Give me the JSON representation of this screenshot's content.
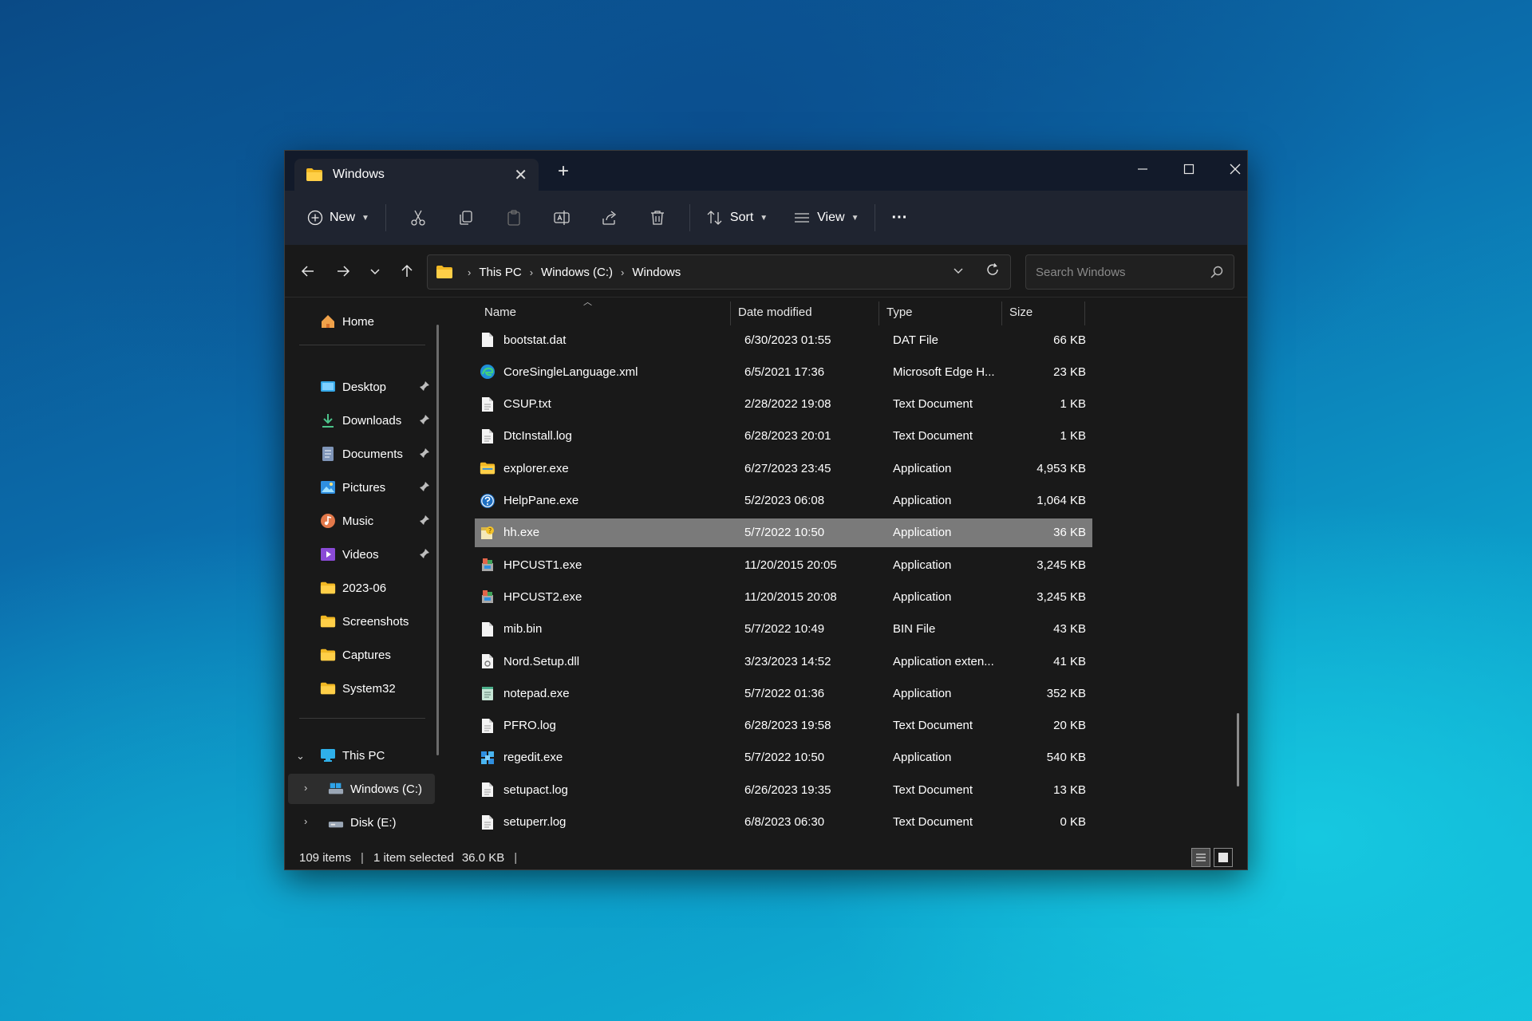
{
  "window": {
    "tab_title": "Windows",
    "new_tab": "+",
    "close_tab": "✕"
  },
  "toolbar": {
    "new_label": "New",
    "sort_label": "Sort",
    "view_label": "View",
    "more_label": "···"
  },
  "address": {
    "crumbs": [
      "This PC",
      "Windows (C:)",
      "Windows"
    ]
  },
  "search": {
    "placeholder": "Search Windows"
  },
  "sidebar": {
    "home": "Home",
    "quick": [
      {
        "label": "Desktop",
        "icon": "desktop-icon"
      },
      {
        "label": "Downloads",
        "icon": "download-icon"
      },
      {
        "label": "Documents",
        "icon": "document-icon"
      },
      {
        "label": "Pictures",
        "icon": "pictures-icon"
      },
      {
        "label": "Music",
        "icon": "music-icon"
      },
      {
        "label": "Videos",
        "icon": "videos-icon"
      },
      {
        "label": "2023-06",
        "icon": "folder-icon"
      },
      {
        "label": "Screenshots",
        "icon": "folder-icon"
      },
      {
        "label": "Captures",
        "icon": "folder-icon"
      },
      {
        "label": "System32",
        "icon": "folder-icon"
      }
    ],
    "this_pc": "This PC",
    "drives": [
      {
        "label": "Windows (C:)"
      },
      {
        "label": "Disk (E:)"
      }
    ]
  },
  "columns": {
    "name": "Name",
    "date": "Date modified",
    "type": "Type",
    "size": "Size"
  },
  "files": [
    {
      "name": "bootstat.dat",
      "date": "6/30/2023 01:55",
      "type": "DAT File",
      "size": "66 KB",
      "icon": "file-icon"
    },
    {
      "name": "CoreSingleLanguage.xml",
      "date": "6/5/2021 17:36",
      "type": "Microsoft Edge H...",
      "size": "23 KB",
      "icon": "edge-icon"
    },
    {
      "name": "CSUP.txt",
      "date": "2/28/2022 19:08",
      "type": "Text Document",
      "size": "1 KB",
      "icon": "text-file-icon"
    },
    {
      "name": "DtcInstall.log",
      "date": "6/28/2023 20:01",
      "type": "Text Document",
      "size": "1 KB",
      "icon": "text-file-icon"
    },
    {
      "name": "explorer.exe",
      "date": "6/27/2023 23:45",
      "type": "Application",
      "size": "4,953 KB",
      "icon": "explorer-icon"
    },
    {
      "name": "HelpPane.exe",
      "date": "5/2/2023 06:08",
      "type": "Application",
      "size": "1,064 KB",
      "icon": "help-icon"
    },
    {
      "name": "hh.exe",
      "date": "5/7/2022 10:50",
      "type": "Application",
      "size": "36 KB",
      "icon": "hh-icon"
    },
    {
      "name": "HPCUST1.exe",
      "date": "11/20/2015 20:05",
      "type": "Application",
      "size": "3,245 KB",
      "icon": "installer-icon"
    },
    {
      "name": "HPCUST2.exe",
      "date": "11/20/2015 20:08",
      "type": "Application",
      "size": "3,245 KB",
      "icon": "installer-icon"
    },
    {
      "name": "mib.bin",
      "date": "5/7/2022 10:49",
      "type": "BIN File",
      "size": "43 KB",
      "icon": "file-icon"
    },
    {
      "name": "Nord.Setup.dll",
      "date": "3/23/2023 14:52",
      "type": "Application exten...",
      "size": "41 KB",
      "icon": "dll-icon"
    },
    {
      "name": "notepad.exe",
      "date": "5/7/2022 01:36",
      "type": "Application",
      "size": "352 KB",
      "icon": "notepad-icon"
    },
    {
      "name": "PFRO.log",
      "date": "6/28/2023 19:58",
      "type": "Text Document",
      "size": "20 KB",
      "icon": "text-file-icon"
    },
    {
      "name": "regedit.exe",
      "date": "5/7/2022 10:50",
      "type": "Application",
      "size": "540 KB",
      "icon": "regedit-icon"
    },
    {
      "name": "setupact.log",
      "date": "6/26/2023 19:35",
      "type": "Text Document",
      "size": "13 KB",
      "icon": "text-file-icon"
    },
    {
      "name": "setuperr.log",
      "date": "6/8/2023 06:30",
      "type": "Text Document",
      "size": "0 KB",
      "icon": "text-file-icon"
    }
  ],
  "status": {
    "items": "109 items",
    "selected": "1 item selected",
    "size": "36.0 KB"
  }
}
